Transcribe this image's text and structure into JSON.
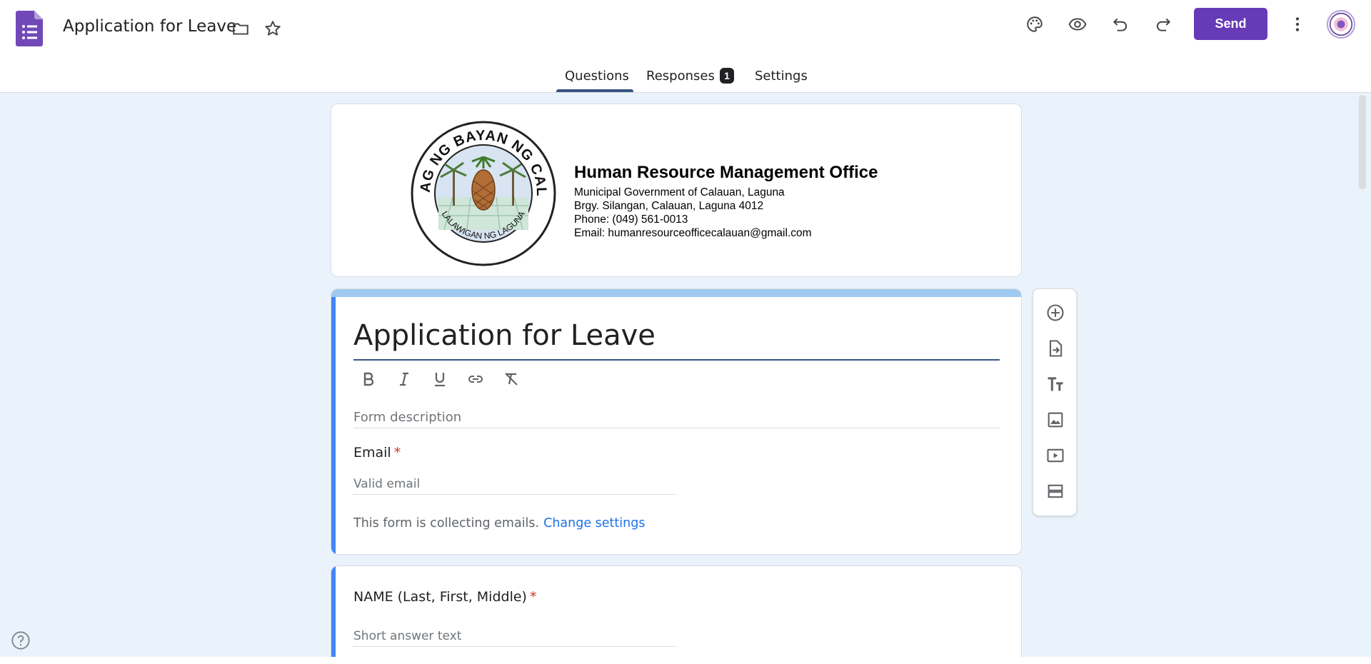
{
  "header": {
    "doc_title": "Application for Leave",
    "send_label": "Send"
  },
  "tabs": [
    {
      "label": "Questions",
      "active": true
    },
    {
      "label": "Responses",
      "badge": "1"
    },
    {
      "label": "Settings"
    }
  ],
  "banner": {
    "seal_top_text": "SAGISAG NG BAYAN NG CALAUAN",
    "seal_bottom_text": "LALAWIGAN NG LAGUNA",
    "office_name": "Human Resource Management Office",
    "lines": [
      "Municipal Government of Calauan, Laguna",
      "Brgy. Silangan, Calauan, Laguna 4012",
      "Phone:  (049) 561-0013",
      "Email:  humanresourceofficecalauan@gmail.com"
    ]
  },
  "form": {
    "title": "Application for Leave",
    "description_placeholder": "Form description",
    "email_label": "Email",
    "required_mark": "*",
    "email_placeholder": "Valid email",
    "collecting_text": "This form is collecting emails.",
    "change_settings": "Change settings"
  },
  "question1": {
    "label": "NAME (Last, First, Middle)",
    "placeholder": "Short answer text"
  },
  "icons": {
    "header": [
      "forms-app-icon",
      "folder-icon",
      "star-icon",
      "palette-icon",
      "eye-icon",
      "undo-icon",
      "redo-icon",
      "more-vert-icon"
    ],
    "format": [
      "bold-icon",
      "italic-icon",
      "underline-icon",
      "link-icon",
      "clear-format-icon"
    ],
    "toolbar": [
      "add-question-icon",
      "import-questions-icon",
      "add-title-icon",
      "add-image-icon",
      "add-video-icon",
      "add-section-icon"
    ],
    "help": "help-icon"
  },
  "colors": {
    "brand": "#673ab7",
    "accent": "#4285f4",
    "link": "#1a73e8",
    "required": "#d93025",
    "canvas": "#eaf2fb"
  }
}
